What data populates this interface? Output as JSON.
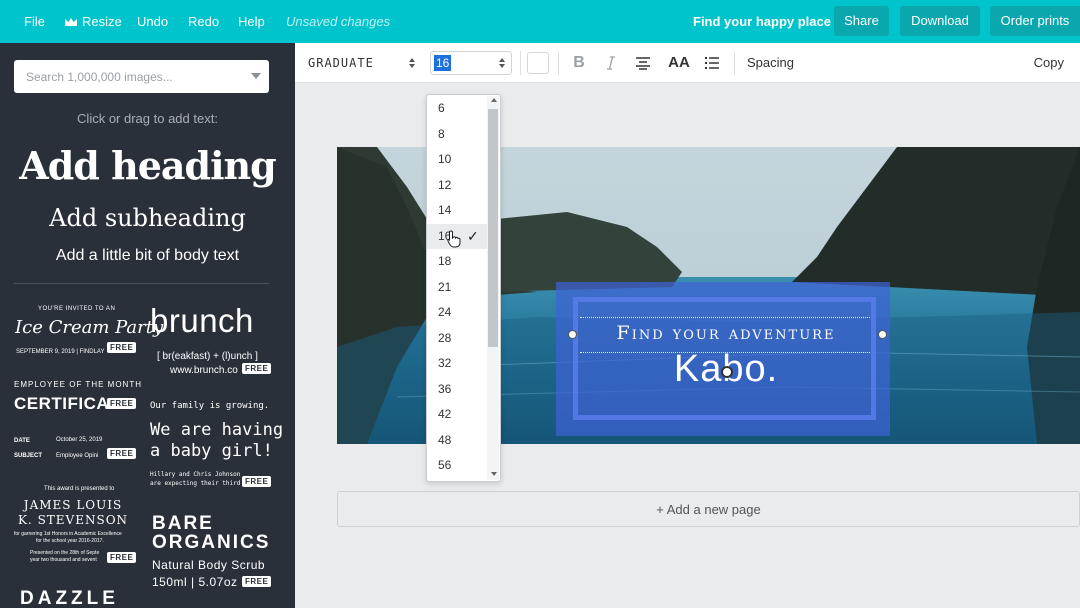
{
  "topbar": {
    "menu": [
      "File",
      "Resize",
      "Undo",
      "Redo",
      "Help"
    ],
    "status": "Unsaved changes",
    "tagline": "Find your happy place",
    "share": "Share",
    "download": "Download",
    "order_prints": "Order prints"
  },
  "sidebar": {
    "search_placeholder": "Search 1,000,000 images...",
    "hint": "Click or drag to add text:",
    "heading": "Add heading",
    "subheading": "Add subheading",
    "body": "Add a little bit of body text",
    "free_badge": "FREE",
    "templates": {
      "ice_cream": {
        "top": "YOU'RE INVITED TO AN",
        "title": "Ice Cream Party",
        "date": "SEPTEMBER 9, 2019 | FINDLAY"
      },
      "brunch": {
        "title": "brunch",
        "sub": "[ br(eakfast) + (l)unch ]",
        "url": "www.brunch.co"
      },
      "certificate": {
        "top": "EMPLOYEE OF THE MONTH",
        "title": "CERTIFICA",
        "date_label": "DATE",
        "date_value": "October 25, 2019",
        "subject_label": "SUBJECT",
        "subject_value": "Employee Opini"
      },
      "baby": {
        "top": "Our family is growing.",
        "line1": "We are having",
        "line2": "a baby girl!",
        "note1": "Hillary and Chris Johnson",
        "note2": "are expecting their third child"
      },
      "award": {
        "top": "This award is presented to",
        "name1": "JAMES LOUIS",
        "name2": "K. STEVENSON",
        "line1": "for garnering 1st Honors in Academic Excellence",
        "line2": "for the school year 2016-2017.",
        "line3": "Presented on the 28th of Septe",
        "line4": "year two thousand and sevent"
      },
      "bare": {
        "line1": "BARE",
        "line2": "ORGANICS",
        "line3": "Natural Body Scrub",
        "line4": "150ml | 5.07oz"
      },
      "dazzle": {
        "title": "DAZZLE"
      }
    }
  },
  "toolbar": {
    "font": "GRADUATE",
    "size": "16",
    "spacing": "Spacing",
    "copy": "Copy",
    "icons": [
      "bold-icon",
      "italic-icon",
      "align-center-icon",
      "letter-case-icon",
      "list-icon"
    ]
  },
  "font_size_dropdown": {
    "options": [
      "6",
      "8",
      "10",
      "12",
      "14",
      "16",
      "18",
      "21",
      "24",
      "28",
      "32",
      "36",
      "42",
      "48",
      "56"
    ],
    "selected": "16",
    "checkmark": "✓"
  },
  "design": {
    "headline": "Find your adventure",
    "brand": "Kabo."
  },
  "add_page": "+ Add a new page",
  "colors": {
    "accent": "#00c4cc",
    "sidebar": "#293039",
    "selection": "#3f62d6"
  }
}
